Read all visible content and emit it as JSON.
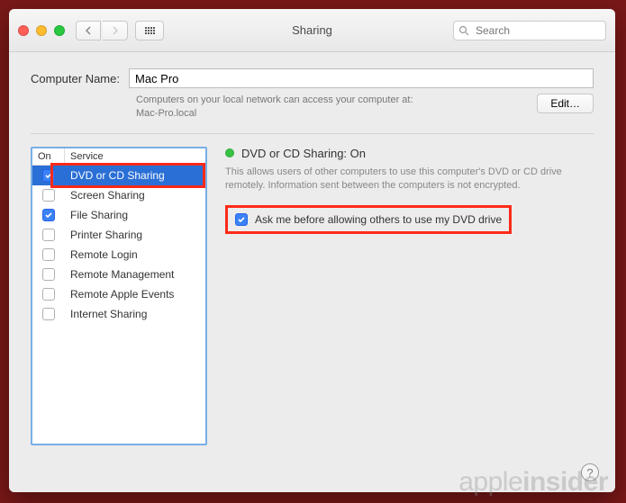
{
  "window": {
    "title": "Sharing",
    "search_placeholder": "Search"
  },
  "computer_name": {
    "label": "Computer Name:",
    "value": "Mac Pro",
    "description": "Computers on your local network can access your computer at:\nMac-Pro.local",
    "edit_label": "Edit…"
  },
  "service_list": {
    "header_on": "On",
    "header_service": "Service",
    "items": [
      {
        "label": "DVD or CD Sharing",
        "checked": true,
        "selected": true
      },
      {
        "label": "Screen Sharing",
        "checked": false,
        "selected": false
      },
      {
        "label": "File Sharing",
        "checked": true,
        "selected": false
      },
      {
        "label": "Printer Sharing",
        "checked": false,
        "selected": false
      },
      {
        "label": "Remote Login",
        "checked": false,
        "selected": false
      },
      {
        "label": "Remote Management",
        "checked": false,
        "selected": false
      },
      {
        "label": "Remote Apple Events",
        "checked": false,
        "selected": false
      },
      {
        "label": "Internet Sharing",
        "checked": false,
        "selected": false
      }
    ]
  },
  "detail": {
    "status_title": "DVD or CD Sharing: On",
    "status_description": "This allows users of other computers to use this computer's DVD or CD drive remotely. Information sent between the computers is not encrypted.",
    "ask_checkbox_label": "Ask me before allowing others to use my DVD drive",
    "ask_checked": true,
    "status_color": "#38c142"
  },
  "watermark": {
    "brand1": "apple",
    "brand2": "insider"
  },
  "help_label": "?"
}
